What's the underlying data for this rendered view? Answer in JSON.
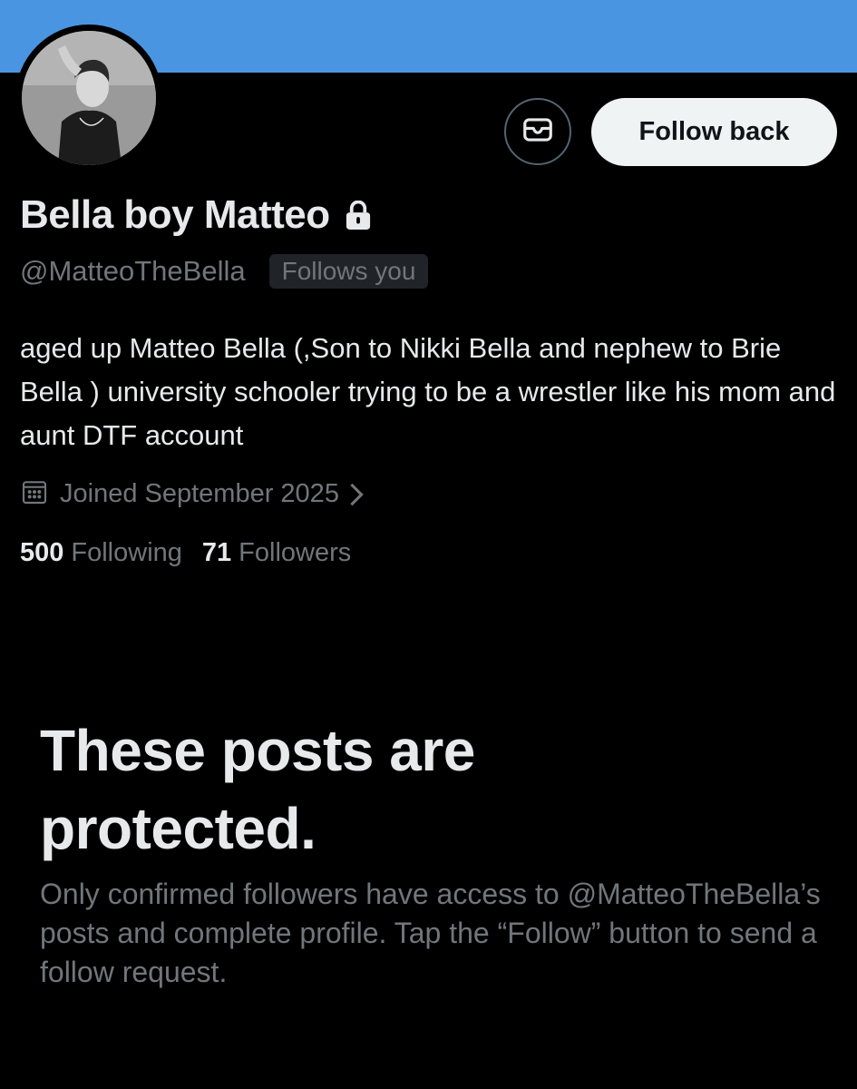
{
  "profile": {
    "display_name": "Bella boy Matteo",
    "handle": "@MatteoTheBella",
    "follows_you_badge": "Follows you",
    "bio": "aged up Matteo Bella (,Son to Nikki Bella and nephew to Brie Bella ) university schooler trying to be a wrestler like his mom and aunt DTF account",
    "joined": "Joined September 2025",
    "following_count": "500",
    "following_label": "Following",
    "followers_count": "71",
    "followers_label": "Followers"
  },
  "actions": {
    "follow_back_label": "Follow back"
  },
  "protected": {
    "title": "These posts are protected.",
    "description": "Only confirmed followers have access to @MatteoTheBella’s posts and complete profile. Tap the “Follow” button to send a follow request."
  },
  "icons": {
    "message": "message-icon",
    "lock": "lock-icon",
    "calendar": "calendar-icon",
    "chevron": "chevron-right-icon"
  },
  "colors": {
    "banner": "#4a95e1",
    "background": "#000000",
    "primary_text": "#e7e9ea",
    "secondary_text": "#71767b",
    "button_bg": "#eff3f4"
  }
}
